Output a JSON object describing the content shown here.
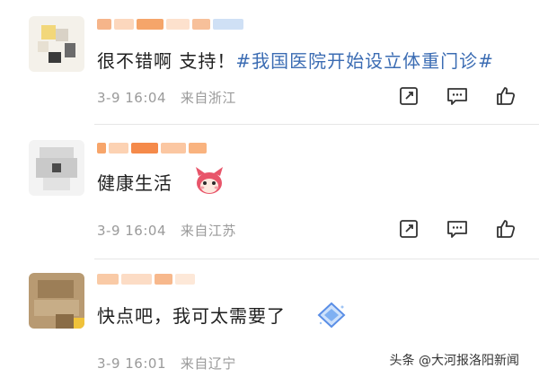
{
  "comments": [
    {
      "text_plain": "很不错啊 支持！",
      "topic": "#我国医院开始设立体重门诊#",
      "time": "3-9 16:04",
      "location": "来自浙江"
    },
    {
      "text_plain": "健康生活",
      "topic": "",
      "time": "3-9 16:04",
      "location": "来自江苏"
    },
    {
      "text_plain": "快点吧，我可太需要了",
      "topic": "",
      "time": "3-9 16:01",
      "location": "来自辽宁"
    }
  ],
  "icons": {
    "share": "share-icon",
    "comment": "comment-icon",
    "like": "like-icon",
    "sticker_fox": "fox-sticker-icon",
    "sticker_gem": "gem-sticker-icon"
  },
  "colors": {
    "topic": "#3b6cb3",
    "meta": "#9a9a9a",
    "username_blur": "#f5a56a"
  },
  "watermark": "头条 @大河报洛阳新闻"
}
